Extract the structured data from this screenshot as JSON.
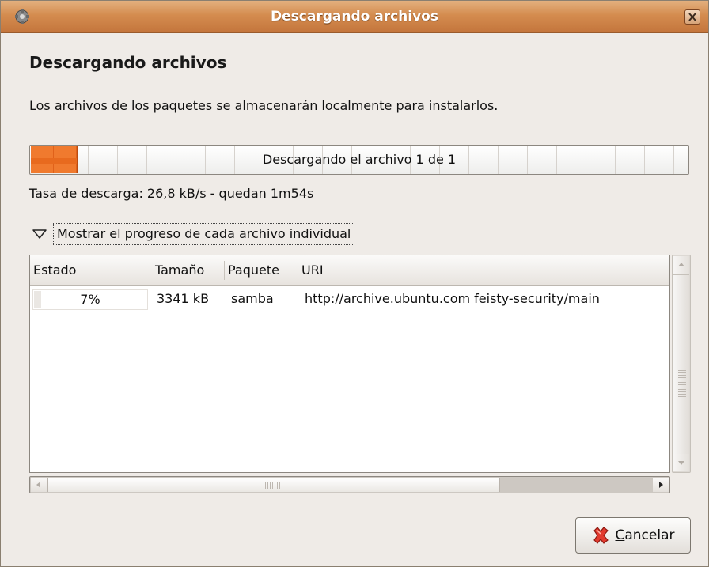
{
  "window": {
    "title": "Descargando archivos"
  },
  "heading": "Descargando archivos",
  "description": "Los archivos de los paquetes se almacenarán localmente para instalarlos.",
  "progress": {
    "text": "Descargando el archivo 1 de 1",
    "fraction": 0.07,
    "color": "#f07a2e"
  },
  "rate": "Tasa de descarga: 26,8 kB/s - quedan 1m54s",
  "expander": {
    "label": "Mostrar el progreso de cada archivo individual",
    "expanded": true
  },
  "table": {
    "columns": [
      "Estado",
      "Tamaño",
      "Paquete",
      "URI"
    ],
    "rows": [
      {
        "status": "7%",
        "size": "3341 kB",
        "package": "samba",
        "uri": "http://archive.ubuntu.com feisty-security/main"
      }
    ]
  },
  "buttons": {
    "cancel": {
      "mnemonic": "C",
      "rest": "ancelar",
      "icon": "cancel-icon"
    }
  },
  "colors": {
    "titlebar": "#d48c4f",
    "background": "#efebe7"
  }
}
